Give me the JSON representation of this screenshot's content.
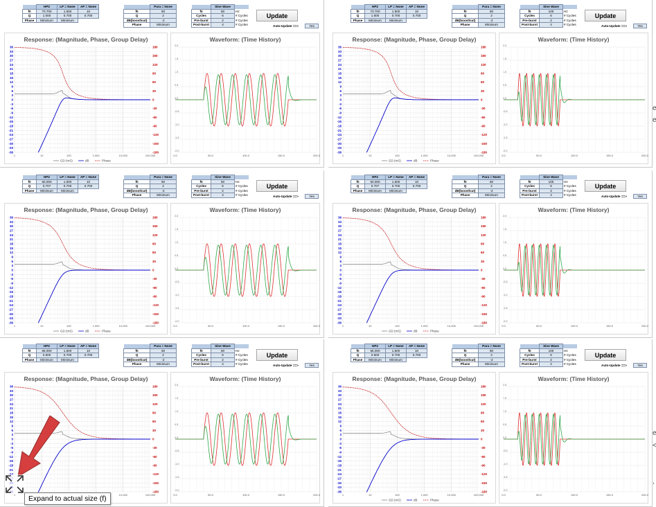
{
  "panels": [
    {
      "filters": {
        "hp2": {
          "title": "HP2",
          "f0": "70.700",
          "q": "1.000",
          "phase": "Minimum"
        },
        "lp": {
          "title": "LP = None",
          "f0": "1.500",
          "q": "0.700",
          "phase": "Minimum"
        },
        "ap": {
          "title": "AP = None",
          "f0": "10",
          "q": "0.700"
        }
      },
      "para": {
        "title": "Para = None",
        "f0": "60",
        "q": "2",
        "db": "-2",
        "phase": "Minimum"
      },
      "sine": {
        "title": "Sine Wave",
        "f0": "50",
        "f0_unit": "Hz",
        "cycles": "6",
        "pre_burst": "2",
        "post_burst": "4"
      },
      "auto_update": "Yes"
    },
    {
      "filters": {
        "hp2": {
          "title": "HP2",
          "f0": "73.700",
          "q": "1.000",
          "phase": "Minimum"
        },
        "lp": {
          "title": "LP = None",
          "f0": "1.500",
          "q": "0.700",
          "phase": "Minimum"
        },
        "ap": {
          "title": "AP = None",
          "f0": "10",
          "q": "0.700"
        }
      },
      "para": {
        "title": "Para = None",
        "f0": "60",
        "q": "2",
        "db": "-2",
        "phase": "Minimum"
      },
      "sine": {
        "title": "Sine Wave",
        "f0": "100",
        "f0_unit": "Hz",
        "cycles": "6",
        "pre_burst": "2",
        "post_burst": "4"
      },
      "auto_update": "Yes"
    },
    {
      "filters": {
        "hp2": {
          "title": "HP2",
          "f0": "50.000",
          "q": "0.707",
          "phase": "Minimum"
        },
        "lp": {
          "title": "LP = None",
          "f0": "1.500",
          "q": "0.700",
          "phase": "Minimum"
        },
        "ap": {
          "title": "AP = None",
          "f0": "10",
          "q": "0.700"
        }
      },
      "para": {
        "title": "Para = None",
        "f0": "60",
        "q": "2",
        "db": "-2",
        "phase": "Minimum"
      },
      "sine": {
        "title": "Sine Wave",
        "f0": "50",
        "f0_unit": "Hz",
        "cycles": "6",
        "pre_burst": "2",
        "post_burst": "4"
      },
      "auto_update": "Yes"
    },
    {
      "filters": {
        "hp2": {
          "title": "HP2",
          "f0": "50.000",
          "q": "0.707",
          "phase": "Minimum"
        },
        "lp": {
          "title": "LP = None",
          "f0": "1.500",
          "q": "0.700",
          "phase": "Minimum"
        },
        "ap": {
          "title": "AP = None",
          "f0": "10",
          "q": "0.700"
        }
      },
      "para": {
        "title": "Para = None",
        "f0": "60",
        "q": "2",
        "db": "-2",
        "phase": "Minimum"
      },
      "sine": {
        "title": "Sine Wave",
        "f0": "100",
        "f0_unit": "Hz",
        "cycles": "6",
        "pre_burst": "2",
        "post_burst": "4"
      },
      "auto_update": "Yes"
    },
    {
      "filters": {
        "hp2": {
          "title": "HP2",
          "f0": "65.000",
          "q": "0.500",
          "phase": "Minimum"
        },
        "lp": {
          "title": "LP = None",
          "f0": "1.500",
          "q": "0.700",
          "phase": "Minimum"
        },
        "ap": {
          "title": "AP = None",
          "f0": "10",
          "q": "0.700"
        }
      },
      "para": {
        "title": "Para = None",
        "f0": "60",
        "q": "2",
        "db": "-2",
        "phase": "Minimum"
      },
      "sine": {
        "title": "Sine Wave",
        "f0": "50",
        "f0_unit": "Hz",
        "cycles": "6",
        "pre_burst": "2",
        "post_burst": "4"
      },
      "auto_update": "Yes"
    },
    {
      "filters": {
        "hp2": {
          "title": "HP2",
          "f0": "65.000",
          "q": "0.500",
          "phase": "Minimum"
        },
        "lp": {
          "title": "LP = None",
          "f0": "1.500",
          "q": "0.700",
          "phase": "Minimum"
        },
        "ap": {
          "title": "AP = None",
          "f0": "10",
          "q": "0.700"
        }
      },
      "para": {
        "title": "Para = None",
        "f0": "60",
        "q": "2",
        "db": "-2",
        "phase": "Minimum"
      },
      "sine": {
        "title": "Sine Wave",
        "f0": "100",
        "f0_unit": "Hz",
        "cycles": "6",
        "pre_burst": "2",
        "post_burst": "4"
      },
      "auto_update": "Yes"
    }
  ],
  "labels": {
    "f0": "f0",
    "q": "Q",
    "phase": "Phase",
    "db": "dB(boost/cut)",
    "cycles": "Cycles",
    "pre_burst": "Pre-burst",
    "post_burst": "Post-burst",
    "cycles_unit": "# Cycles",
    "update": "Update",
    "auto_update": "Auto-Update ==>",
    "response_title": "Response: (Magnitude, Phase, Group Delay)",
    "waveform_title": "Waveform: (Time History)",
    "legend": [
      "GD (mS)",
      "dB",
      "Phase"
    ]
  },
  "chart_data": [
    {
      "type": "line",
      "title": "Response: (Magnitude, Phase, Group Delay)",
      "x_scale": "log",
      "x_ticks": [
        "1",
        "10",
        "100",
        "1,000",
        "10,000",
        "100,000"
      ],
      "y_left_ticks": [
        "36",
        "33",
        "30",
        "27",
        "24",
        "21",
        "18",
        "15",
        "12",
        "9",
        "6",
        "3",
        "0",
        "-3",
        "-6",
        "-9",
        "-12",
        "-15",
        "-18",
        "-21",
        "-24",
        "-27",
        "-30",
        "-33",
        "-36"
      ],
      "y_right_ticks": [
        "180",
        "150",
        "120",
        "90",
        "60",
        "30",
        "0",
        "-30",
        "-60",
        "-90",
        "-120",
        "-150",
        "-180"
      ],
      "series": [
        {
          "name": "GD (mS)",
          "color": "#7f7f7f"
        },
        {
          "name": "dB",
          "color": "#0000cc"
        },
        {
          "name": "Phase",
          "color": "#c00000"
        }
      ]
    },
    {
      "type": "line",
      "title": "Waveform: (Time History)",
      "x_ticks": [
        "0.0",
        "50.0",
        "100.0",
        "150.0",
        "200.0"
      ],
      "y_ticks": [
        "2.0",
        "1.5",
        "1.0",
        "0.5",
        "0.0",
        "-0.5",
        "-1.0",
        "-1.5",
        "-2.0"
      ],
      "series": [
        {
          "color": "#e03030"
        },
        {
          "color": "#2ea84a"
        }
      ]
    }
  ],
  "colors": {
    "header_fill": "#b8cce4",
    "value_fill": "#dce6f1",
    "gd_line": "#7f7f7f",
    "db_line": "#0000cc",
    "phase_line": "#c00000",
    "input_wave": "#e03030",
    "output_wave": "#2ea84a"
  },
  "tooltip": "Expand to actual size (f)"
}
